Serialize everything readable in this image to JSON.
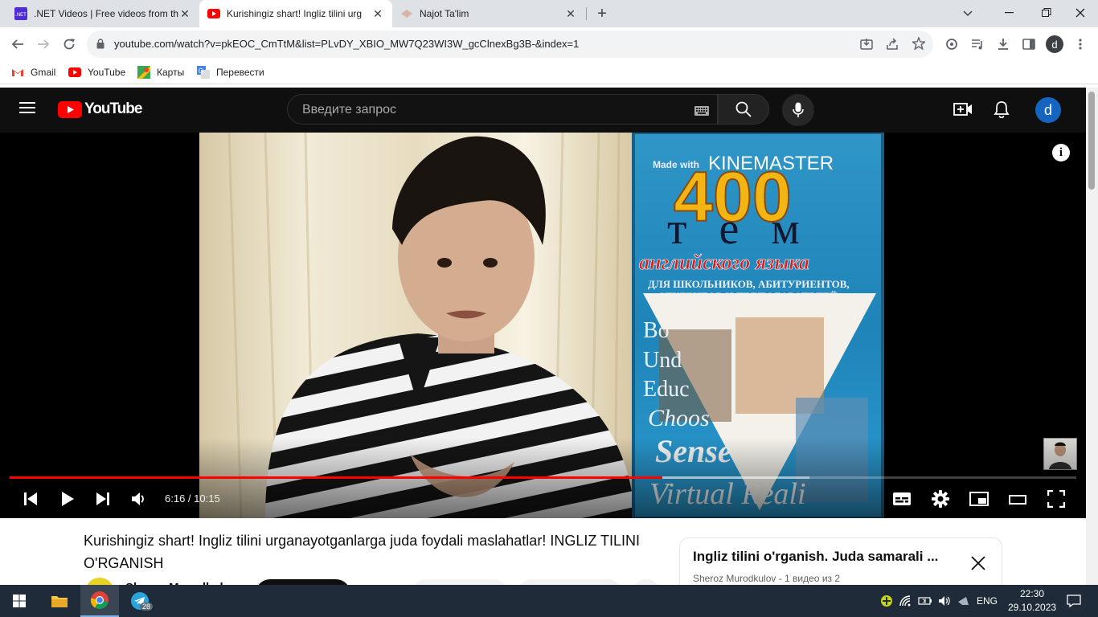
{
  "browser": {
    "tabs": [
      {
        "title": ".NET Videos | Free videos from th",
        "favicon": "dotnet-icon"
      },
      {
        "title": "Kurishingiz shart! Ingliz tilini urg",
        "favicon": "youtube-icon"
      },
      {
        "title": "Najot Ta'lim",
        "favicon": "najot-icon"
      }
    ],
    "url": "youtube.com/watch?v=pkEOC_CmTtM&list=PLvDY_XBIO_MW7Q23WI3W_gcClnexBg3B-&index=1",
    "profile_initial": "d",
    "bookmarks": [
      {
        "label": "Gmail"
      },
      {
        "label": "YouTube"
      },
      {
        "label": "Карты"
      },
      {
        "label": "Перевести"
      }
    ]
  },
  "youtube": {
    "logo_text": "YouTube",
    "search_placeholder": "Введите запрос",
    "avatar_initial": "d",
    "player": {
      "time": "6:16 / 10:15",
      "progress": 0.612,
      "buffered": 0.75,
      "book_lines": [
        "Made with KINEMASTER",
        "400",
        "т е м",
        "английского языка",
        "ДЛЯ ШКОЛЬНИКОВ, АБИТУРИЕНТОВ,",
        "СТУДЕНТОВ И ПРЕПОДАВАТЕЛЕЙ"
      ]
    },
    "video_title": "Kurishingiz shart! Ingliz tilini urganayotganlarga juda foydali maslahatlar! INGLIZ TILINI O'RGANISH",
    "channel_name": "Sheroz Murodkulov",
    "playlist": {
      "title": "Ingliz tilini o'rganish. Juda samarali ...",
      "meta": "Sheroz Murodkulov - 1 видео из 2"
    }
  },
  "taskbar": {
    "language": "ENG",
    "time": "22:30",
    "date": "29.10.2023",
    "telegram_badge": "28"
  },
  "colors": {
    "youtube_red": "#ff0000",
    "chrome_tabstrip": "#dee1e6",
    "taskbar": "#1f2b39"
  }
}
